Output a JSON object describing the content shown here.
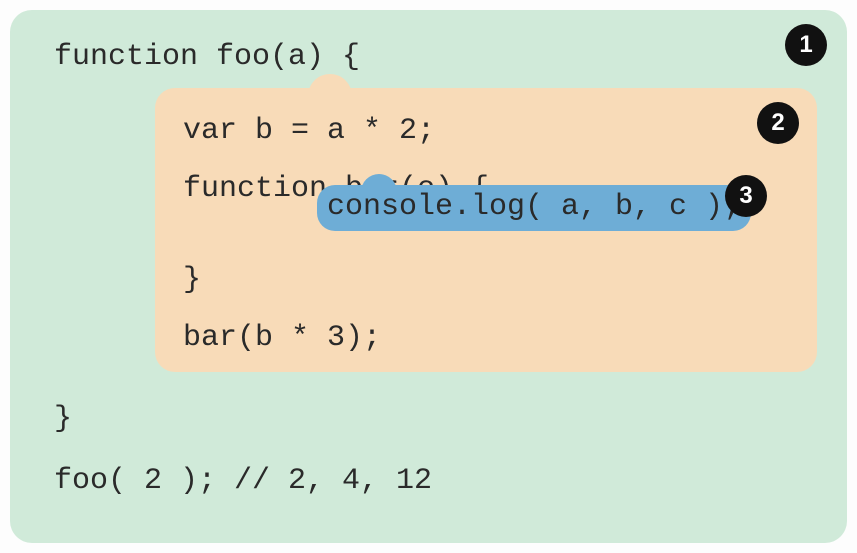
{
  "scope1": {
    "line1": "function foo(a) {",
    "close": "}",
    "call": "foo( 2 ); // 2, 4, 12"
  },
  "scope2": {
    "line1": "var b = a * 2;",
    "line2": "function bar(c) {",
    "close": "}",
    "call": "bar(b * 3);"
  },
  "scope3": {
    "line1": "console.log( a, b, c );"
  },
  "badges": {
    "b1": "1",
    "b2": "2",
    "b3": "3"
  }
}
